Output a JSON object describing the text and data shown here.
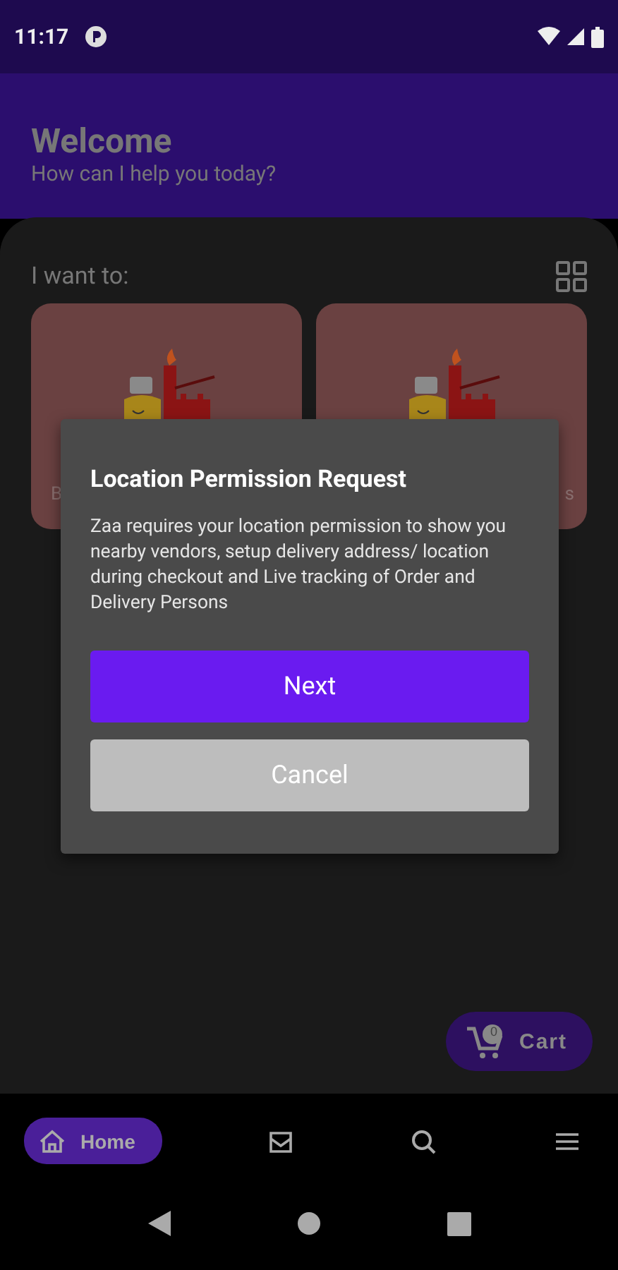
{
  "status_bar": {
    "time": "11:17"
  },
  "header": {
    "title": "Welcome",
    "subtitle": "How can I help you today?"
  },
  "section": {
    "label": "I want to:"
  },
  "cards": [
    {
      "label": "B"
    },
    {
      "label": "s"
    }
  ],
  "dialog": {
    "title": "Location Permission Request",
    "message": "Zaa requires your location permission to show you nearby vendors, setup delivery address/ location during checkout and Live tracking of Order and Delivery Persons",
    "buttons": [
      {
        "label": "Next",
        "kind": "primary"
      },
      {
        "label": "Cancel",
        "kind": "secondary"
      }
    ]
  },
  "cart": {
    "label": "Cart",
    "count": "0"
  },
  "nav": [
    {
      "label": "Home",
      "kind": "home",
      "selected": true
    },
    {
      "kind": "inbox",
      "selected": false
    },
    {
      "kind": "search",
      "selected": false
    },
    {
      "kind": "menu",
      "selected": false
    }
  ]
}
